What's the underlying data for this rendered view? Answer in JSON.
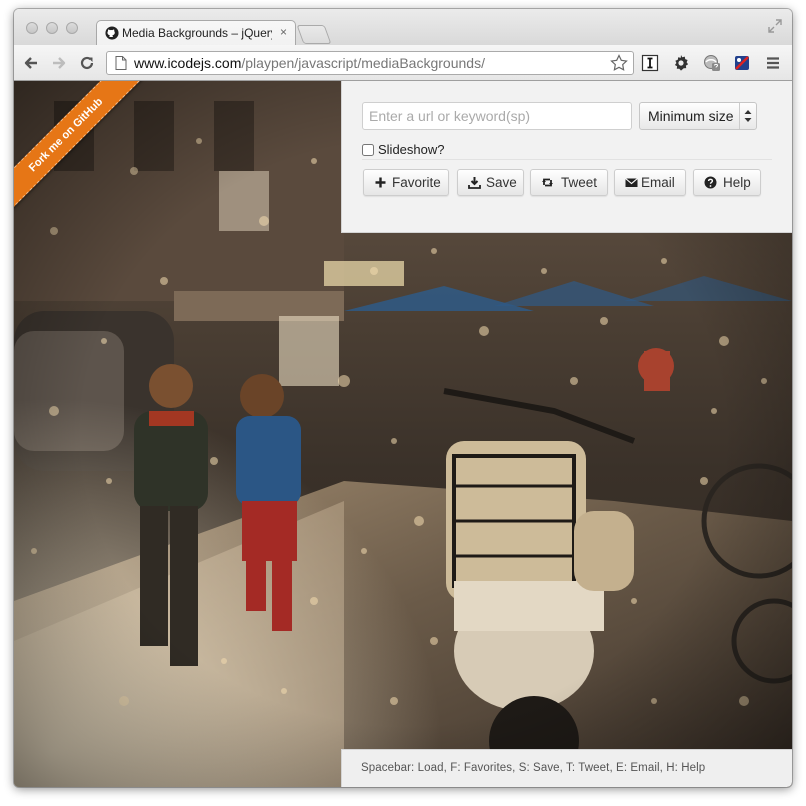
{
  "browser": {
    "tab_title": "Media Backgrounds – jQuery",
    "tab_close": "×",
    "url_host": "www.icodejs.com",
    "url_path": "/playpen/javascript/mediaBackgrounds/"
  },
  "page": {
    "ribbon_text": "Fork me on GitHub",
    "search": {
      "placeholder": "Enter a url or keyword(sp)",
      "value": ""
    },
    "size_select": {
      "selected": "Minimum size"
    },
    "slideshow_label": "Slideshow?",
    "slideshow_checked": false,
    "buttons": {
      "favorite": "Favorite",
      "save": "Save",
      "tweet": "Tweet",
      "email": "Email",
      "help": "Help"
    },
    "shortcuts": "Spacebar: Load, F: Favorites, S: Save, T: Tweet, E: Email, H: Help"
  },
  "icons": {
    "tab": "github-icon",
    "toolbar": [
      "back-icon",
      "forward-icon",
      "reload-icon",
      "page-icon",
      "bookmark-star-icon",
      "instapaper-icon",
      "settings-gear-icon",
      "extension-icon",
      "extension-flag-icon",
      "menu-icon"
    ]
  },
  "colors": {
    "ribbon": "#e67616",
    "panel": "#f2f2f2"
  }
}
